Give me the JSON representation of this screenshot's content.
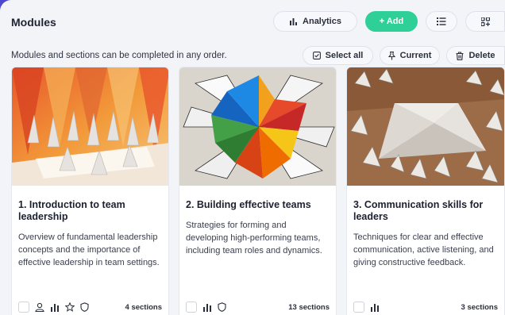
{
  "header": {
    "title": "Modules",
    "analytics_label": "Analytics",
    "add_label": "+ Add"
  },
  "toolbar": {
    "subtitle": "Modules and sections can be completed in any order.",
    "select_all_label": "Select all",
    "current_label": "Current",
    "delete_label": "Delete"
  },
  "modules": [
    {
      "title": "1. Introduction to team leadership",
      "description": "Overview of fundamental leadership concepts and the importance of effective leadership in team settings.",
      "sections": "4 sections",
      "footer_icons": [
        "user-icon",
        "chart-icon",
        "star-icon",
        "shield-icon"
      ]
    },
    {
      "title": "2. Building effective teams",
      "description": "Strategies for forming and developing high-performing teams, including team roles and dynamics.",
      "sections": "13 sections",
      "footer_icons": [
        "chart-icon",
        "shield-icon"
      ]
    },
    {
      "title": "3. Communication skills for leaders",
      "description": "Techniques for clear and effective communication, active listening, and giving constructive feedback.",
      "sections": "3 sections",
      "footer_icons": [
        "chart-icon"
      ]
    }
  ],
  "colors": {
    "accent_green": "#2fcf98",
    "brand_purple": "#5b56d6",
    "panel_bg": "#f3f4f8"
  }
}
